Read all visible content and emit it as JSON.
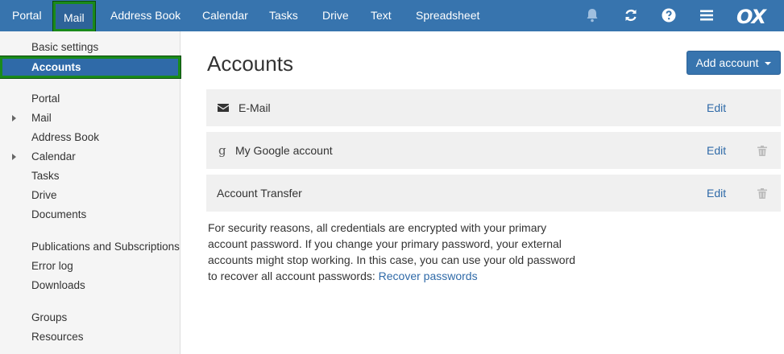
{
  "topbar": {
    "nav": [
      "Portal",
      "Mail",
      "Address Book",
      "Calendar",
      "Tasks",
      "Drive",
      "Text",
      "Spreadsheet"
    ],
    "active": "Mail",
    "icons": [
      "bell-icon",
      "refresh-icon",
      "help-icon",
      "menu-icon"
    ],
    "logo": "OX",
    "colors": {
      "bar": "#3774ae",
      "highlight": "#1a8a1a"
    }
  },
  "sidebar": {
    "group1": [
      "Basic settings",
      "Accounts"
    ],
    "selected": "Accounts",
    "group2": [
      "Portal",
      "Mail",
      "Address Book",
      "Calendar",
      "Tasks",
      "Drive",
      "Documents"
    ],
    "expandable": [
      "Mail",
      "Calendar"
    ],
    "group3": [
      "Publications and Subscriptions",
      "Error log",
      "Downloads"
    ],
    "group4": [
      "Groups",
      "Resources"
    ]
  },
  "main": {
    "title": "Accounts",
    "add_button": "Add account",
    "accounts": [
      {
        "name": "E-Mail",
        "icon": "envelope-icon",
        "edit": "Edit",
        "deletable": false
      },
      {
        "name": "My Google account",
        "icon": "google-icon",
        "edit": "Edit",
        "deletable": true
      },
      {
        "name": "Account Transfer",
        "icon": "",
        "edit": "Edit",
        "deletable": true
      }
    ],
    "note_text": "For security reasons, all credentials are encrypted with your primary account password. If you change your primary password, your external accounts might stop working. In this case, you can use your old password to recover all account passwords: ",
    "note_link": "Recover passwords"
  }
}
